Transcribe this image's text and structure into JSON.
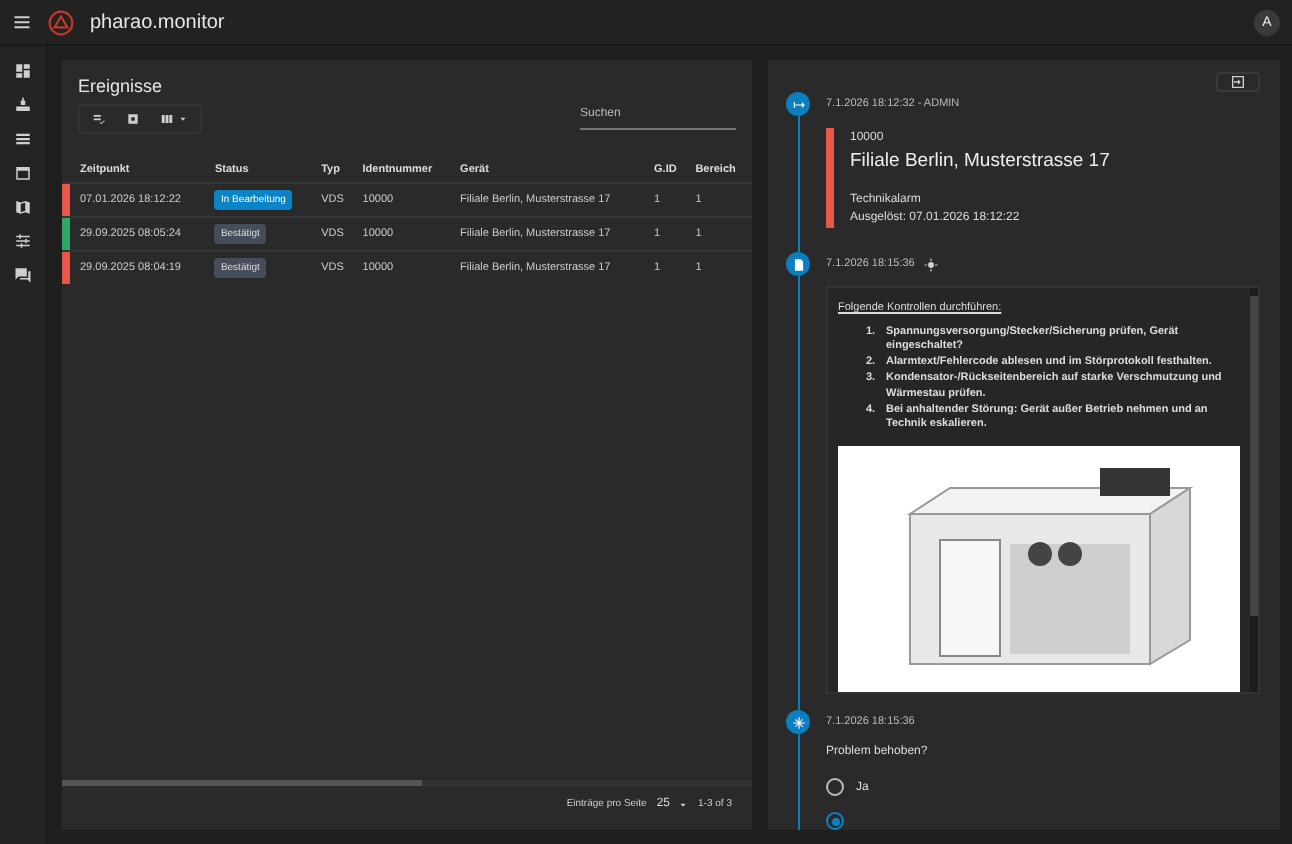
{
  "app": {
    "title": "pharao.monitor",
    "user_initial": "A"
  },
  "events": {
    "title": "Ereignisse",
    "search": {
      "placeholder": "Suchen"
    },
    "columns": [
      "Zeitpunkt",
      "Status",
      "Typ",
      "Identnummer",
      "Gerät",
      "G.ID",
      "Bereich"
    ],
    "rows": [
      {
        "color": "#e8574a",
        "time": "07.01.2026 18:12:22",
        "status": {
          "text": "In Bearbeitung",
          "kind": "active"
        },
        "type": "VDS",
        "ident": "10000",
        "device": "Filiale Berlin, Musterstrasse 17",
        "gid": "1",
        "area": "1"
      },
      {
        "color": "#2ea866",
        "time": "29.09.2025 08:05:24",
        "status": {
          "text": "Bestätigt",
          "kind": "confirmed"
        },
        "type": "VDS",
        "ident": "10000",
        "device": "Filiale Berlin, Musterstrasse 17",
        "gid": "1",
        "area": "1"
      },
      {
        "color": "#e8574a",
        "time": "29.09.2025 08:04:19",
        "status": {
          "text": "Bestätigt",
          "kind": "confirmed"
        },
        "type": "VDS",
        "ident": "10000",
        "device": "Filiale Berlin, Musterstrasse 17",
        "gid": "1",
        "area": "1"
      }
    ],
    "pagination": {
      "label": "Einträge pro Seite",
      "per_page": "25",
      "range": "1-3 of 3"
    }
  },
  "timeline": [
    {
      "kind": "alarm",
      "header": "7.1.2026 18:12:32 - ADMIN",
      "color": "#e8574a",
      "ident": "10000",
      "location": "Filiale Berlin, Musterstrasse 17",
      "type": "Technikalarm",
      "triggered": "Ausgelöst: 07.01.2026 18:12:22"
    },
    {
      "kind": "checklist",
      "header": "7.1.2026 18:15:36",
      "heading": "Folgende Kontrollen durchführen:",
      "steps": [
        {
          "number": "1.",
          "text": "Spannungsversorgung/Stecker/Sicherung prüfen, Gerät eingeschaltet?"
        },
        {
          "number": "2.",
          "text": "Alarmtext/Fehlercode ablesen und im Störprotokoll festhalten."
        },
        {
          "number": "3.",
          "text": "Kondensator-/Rückseitenbereich auf starke Verschmutzung und Wärmestau prüfen."
        },
        {
          "number": "4.",
          "text": "Bei anhaltender Störung: Gerät außer Betrieb nehmen und an Technik eskalieren."
        }
      ]
    },
    {
      "kind": "question",
      "header": "7.1.2026 18:15:36",
      "question": "Problem behoben?",
      "options": [
        {
          "label": "Ja",
          "selected": false
        },
        {
          "selected": true
        }
      ]
    }
  ]
}
